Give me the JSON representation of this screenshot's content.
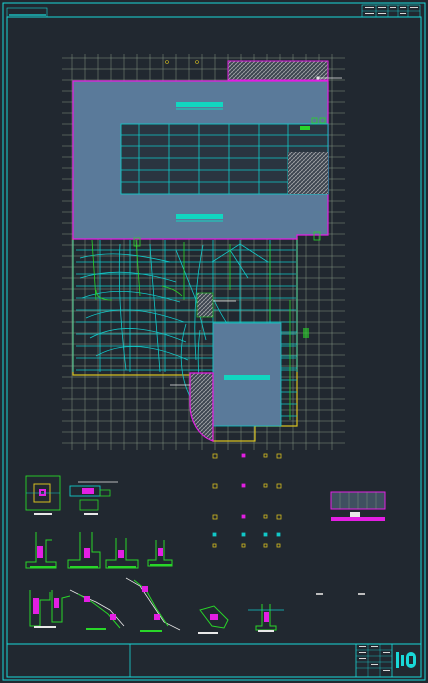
{
  "drawing": {
    "sheet_title": "",
    "note_a": "",
    "note_b": ""
  },
  "colors": {
    "background": "#212830",
    "frame": "#19d8d8",
    "grid": "#8ea08a",
    "beam_cyan": "#12c8c8",
    "beam_green": "#29d629",
    "slab_fill": "#5a7a9a",
    "outline_magenta": "#e31fe3",
    "outline_yellow": "#d8c020",
    "hatch": "#bdbdbd",
    "label_white": "#e8e8e8"
  },
  "icons": {
    "title_block_logo": "logo-icon"
  }
}
